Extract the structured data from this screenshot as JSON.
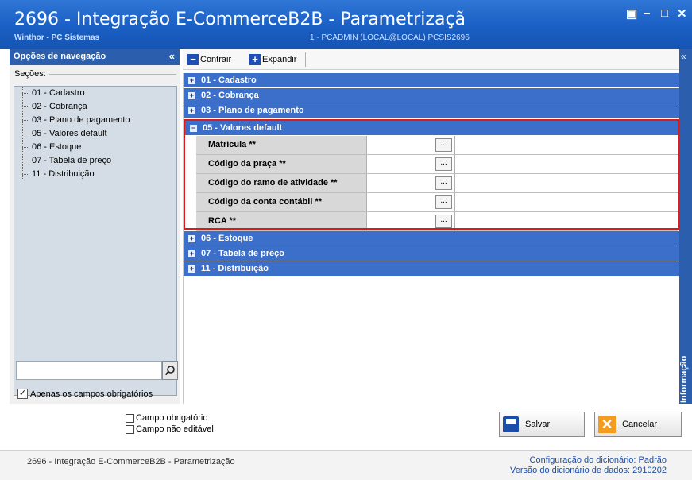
{
  "window": {
    "title": "2696 - Integração E-CommerceB2B - Parametrizaçã",
    "company": "Winthor - PC Sistemas",
    "session": "1 - PCADMIN (LOCAL@LOCAL)   PCSIS2696",
    "controls": [
      "▣",
      "–",
      "□",
      "✕"
    ]
  },
  "nav": {
    "header": "Opções de navegação",
    "collapse_glyph": "«",
    "sections_label": "Seções:",
    "items": [
      "01 - Cadastro",
      "02 - Cobrança",
      "03 - Plano de pagamento",
      "05 - Valores default",
      "06 - Estoque",
      "07 - Tabela de preço",
      "11 - Distribuição"
    ],
    "search_value": "",
    "required_only_label": "Apenas os campos obrigatórios",
    "required_only_checked": "✓"
  },
  "toolbar": {
    "collapse_label": "Contrair",
    "expand_label": "Expandir"
  },
  "grid": {
    "sections_before": [
      {
        "label": "01 - Cadastro",
        "state": "+"
      },
      {
        "label": "02 - Cobrança",
        "state": "+"
      },
      {
        "label": "03 - Plano de pagamento",
        "state": "+"
      }
    ],
    "open_section": {
      "label": "05 - Valores default",
      "state": "−"
    },
    "fields": [
      {
        "label": "Matrícula **",
        "value": "",
        "button": "..."
      },
      {
        "label": "Código da praça **",
        "value": "",
        "button": "..."
      },
      {
        "label": "Código do ramo de atividade **",
        "value": "",
        "button": "..."
      },
      {
        "label": "Código da conta contábil **",
        "value": "",
        "button": "..."
      },
      {
        "label": "RCA **",
        "value": "",
        "button": "..."
      }
    ],
    "sections_after": [
      {
        "label": "06 - Estoque",
        "state": "+"
      },
      {
        "label": "07 - Tabela de preço",
        "state": "+"
      },
      {
        "label": "11 - Distribuição",
        "state": "+"
      }
    ]
  },
  "right_rail": {
    "collapse_glyph": "«",
    "label": "Informação"
  },
  "legend": {
    "required": "Campo obrigatório",
    "not_editable": "Campo não editável"
  },
  "actions": {
    "save_label": "Salvar",
    "cancel_label": "Cancelar"
  },
  "status": {
    "left": "2696 - Integração E-CommerceB2B - Parametrização",
    "dict_config_label": "Configuração do dicionário:",
    "dict_config_value": "Padrão",
    "dict_version_label": "Versão do dicionário de dados:",
    "dict_version_value": "2910202"
  },
  "colors": {
    "title_blue": "#1a5fc4",
    "section_blue": "#3b6fc9",
    "highlight_red": "#d81b1b",
    "cancel_orange": "#f39c1f"
  }
}
